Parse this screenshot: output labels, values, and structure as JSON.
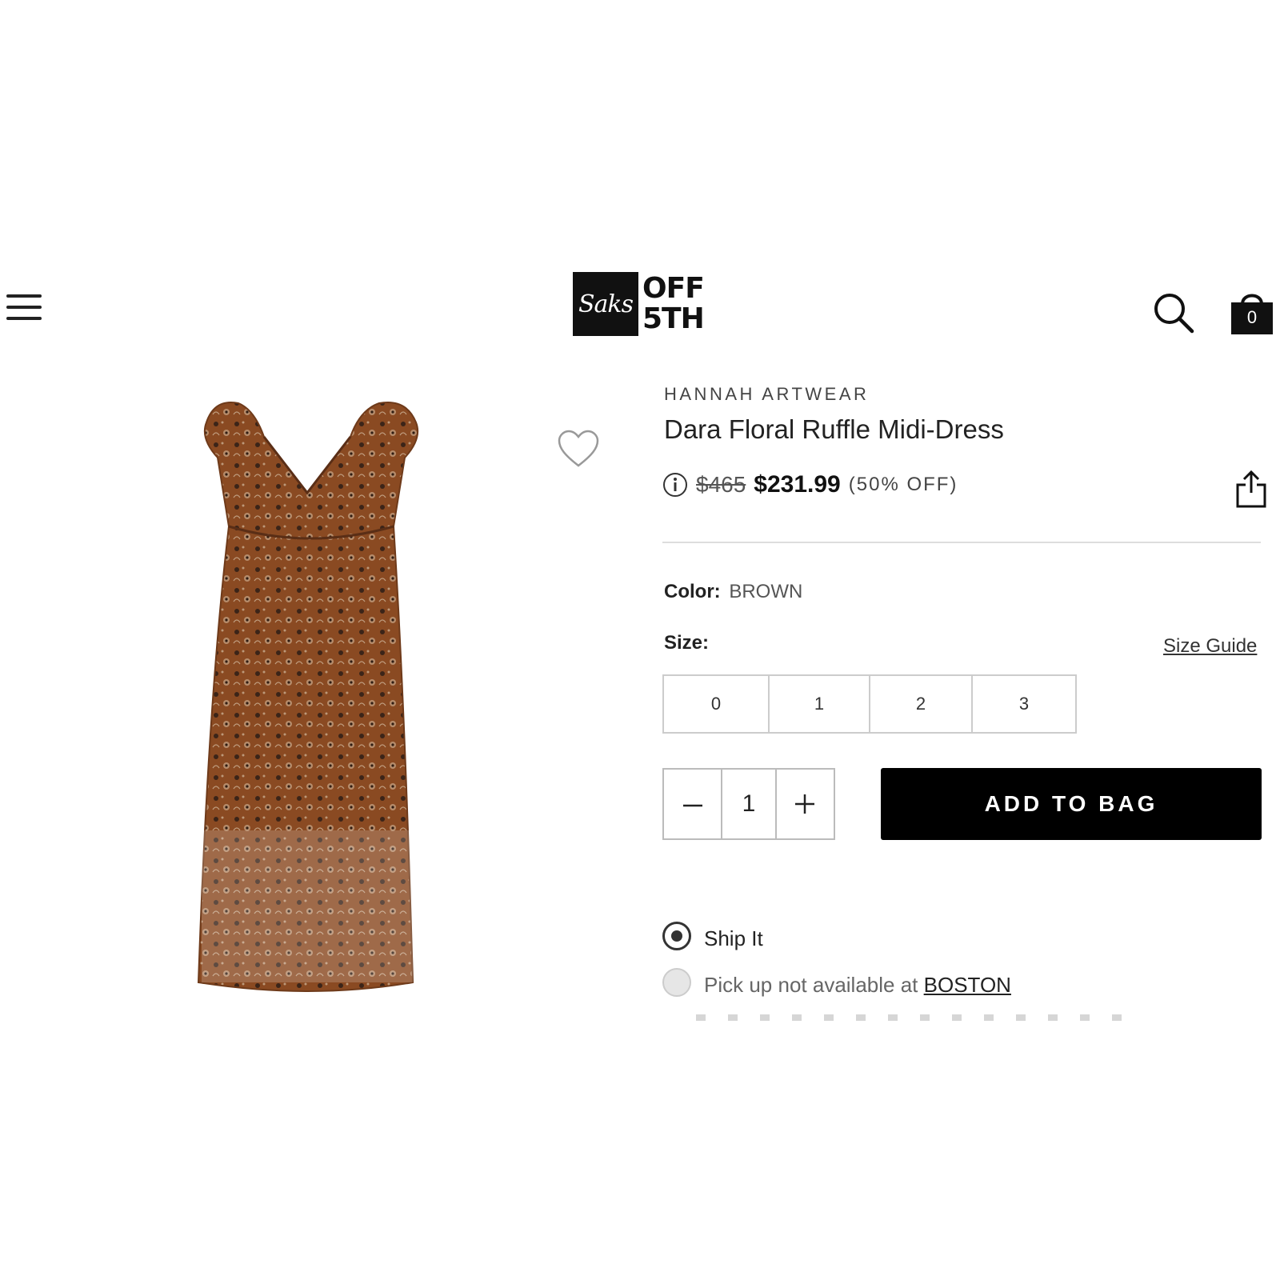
{
  "header": {
    "logo_script": "Saks",
    "logo_line1": "OFF",
    "logo_line2": "5TH",
    "bag_count": "0"
  },
  "product": {
    "brand": "HANNAH ARTWEAR",
    "title": "Dara Floral Ruffle Midi-Dress",
    "original_price": "$465",
    "sale_price": "$231.99",
    "discount": "(50% OFF)",
    "image_color": "#8a4a22"
  },
  "options": {
    "color_label": "Color:",
    "color_value": "BROWN",
    "size_label": "Size:",
    "size_guide": "Size Guide",
    "sizes": [
      "0",
      "1",
      "2",
      "3"
    ]
  },
  "purchase": {
    "quantity": "1",
    "add_to_bag": "ADD TO BAG"
  },
  "fulfillment": {
    "ship_label": "Ship It",
    "pickup_text": "Pick up not available at ",
    "pickup_store": "BOSTON"
  },
  "icons": {
    "menu": "hamburger-menu-icon",
    "search": "search-icon",
    "bag": "shopping-bag-icon",
    "wishlist": "heart-icon",
    "info": "info-icon",
    "share": "share-icon"
  }
}
